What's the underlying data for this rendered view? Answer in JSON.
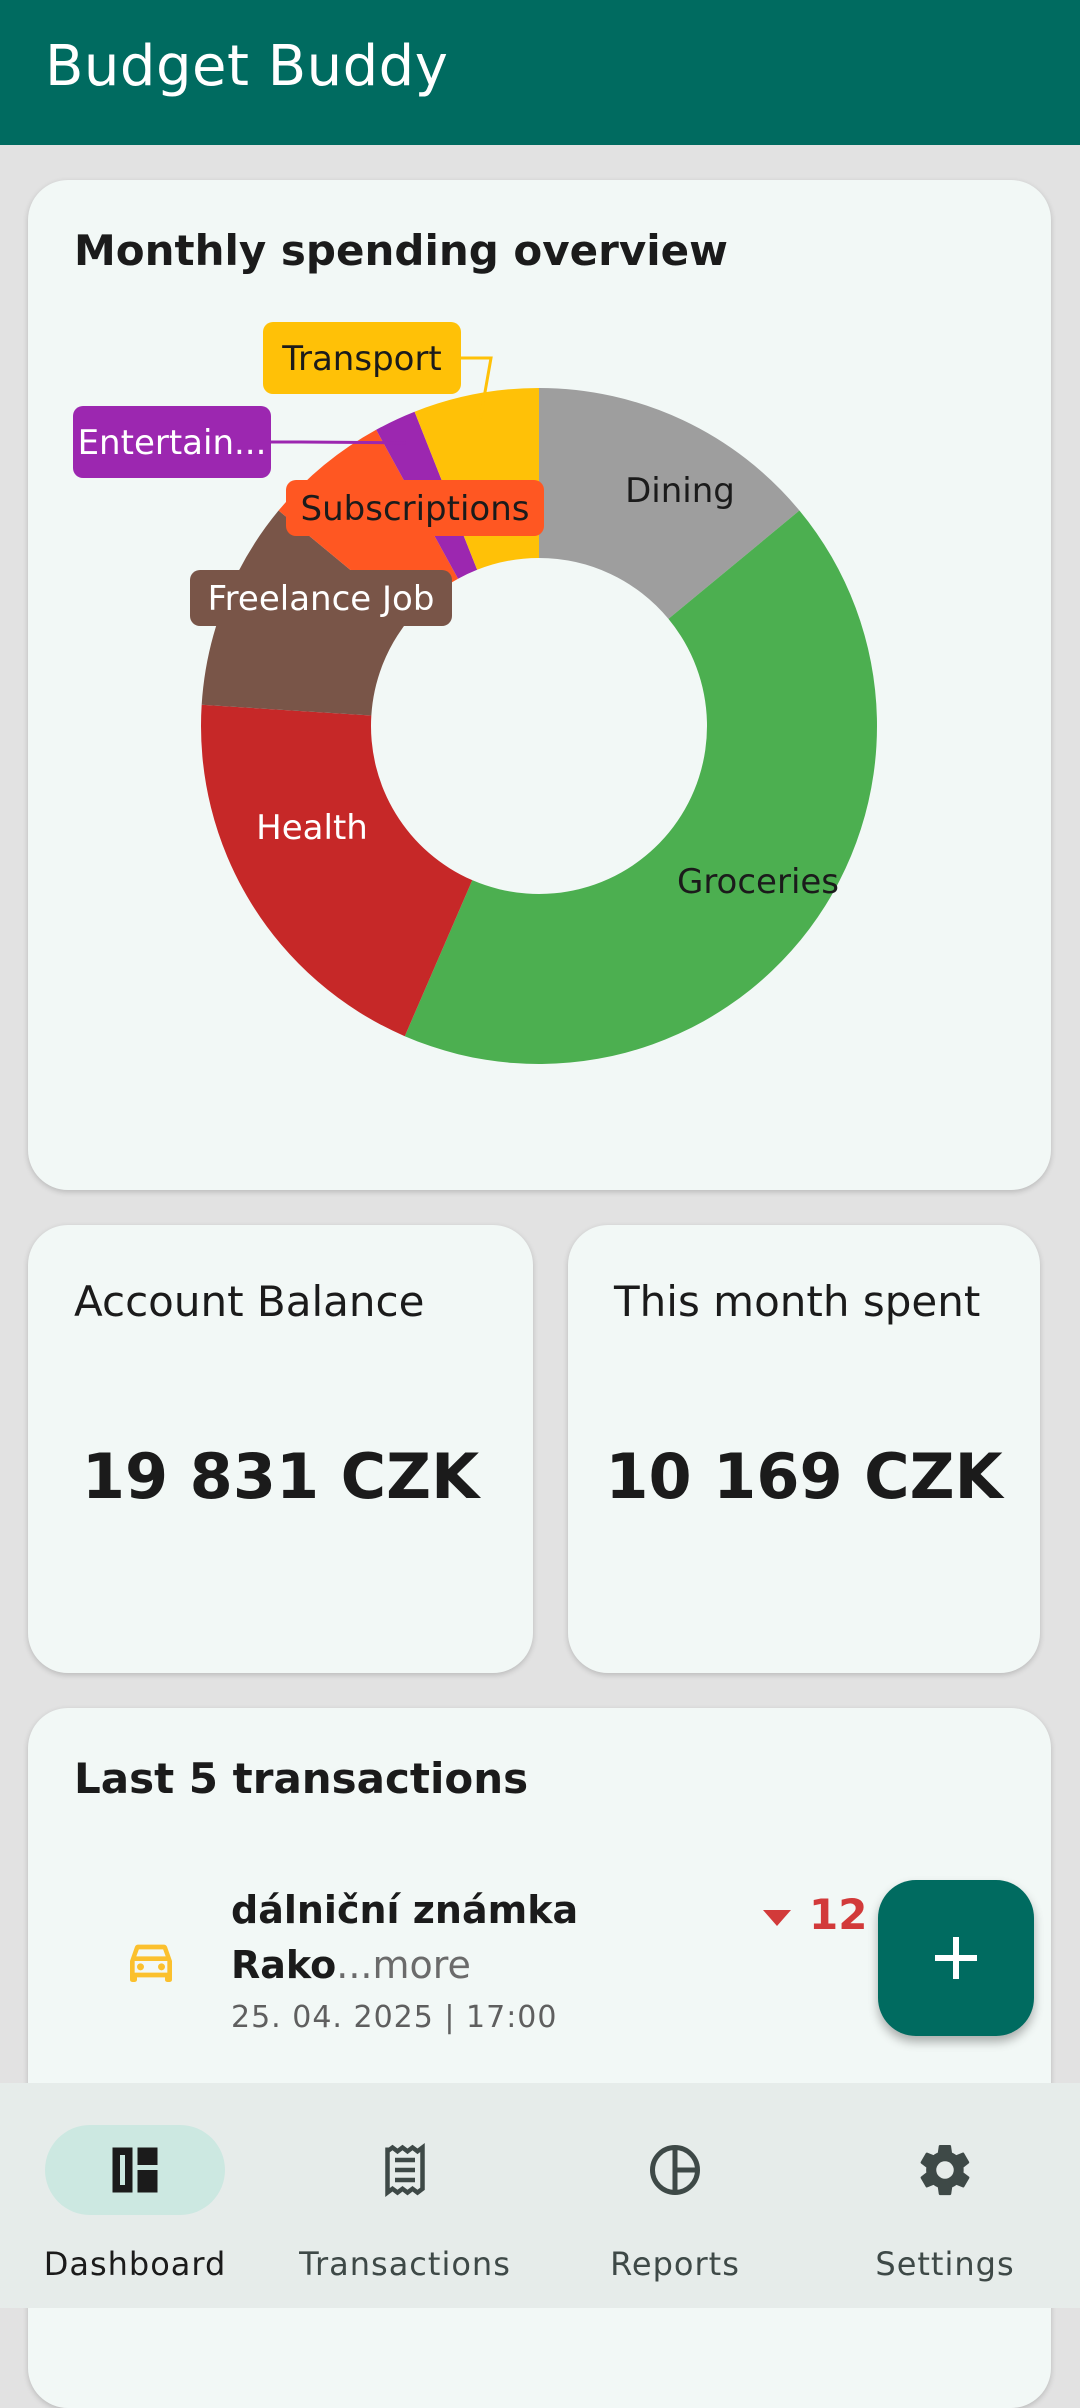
{
  "app": {
    "title": "Budget Buddy"
  },
  "chart_card": {
    "title": "Monthly spending overview"
  },
  "chart_data": {
    "type": "pie",
    "title": "Monthly spending overview",
    "donut": true,
    "series": [
      {
        "name": "Dining",
        "value": 14,
        "color": "#9e9e9e",
        "label": "Dining"
      },
      {
        "name": "Groceries",
        "value": 42.5,
        "color": "#4caf50",
        "label": "Groceries"
      },
      {
        "name": "Health",
        "value": 19.5,
        "color": "#c62828",
        "label": "Health"
      },
      {
        "name": "Freelance Job",
        "value": 10,
        "color": "#795548",
        "label": "Freelance Job"
      },
      {
        "name": "Subscriptions",
        "value": 6,
        "color": "#ff5722",
        "label": "Subscriptions"
      },
      {
        "name": "Entertainment",
        "value": 2,
        "color": "#9c27b0",
        "label": "Entertain..."
      },
      {
        "name": "Transport",
        "value": 6,
        "color": "#ffc107",
        "label": "Transport"
      }
    ]
  },
  "balance": {
    "label": "Account Balance",
    "value": "19 831 CZK"
  },
  "spent": {
    "label": "This month spent",
    "value": "10 169 CZK"
  },
  "transactions": {
    "title": "Last 5 transactions",
    "items": [
      {
        "name": "dálniční známka",
        "desc": "Rako",
        "more": "...more",
        "date": "25. 04. 2025 | 17:00",
        "amount": "12 E",
        "icon": "car-icon",
        "icon_color": "#fbc02d"
      }
    ]
  },
  "fab": {
    "icon": "plus-icon"
  },
  "nav": {
    "items": [
      {
        "label": "Dashboard",
        "icon": "dashboard-icon",
        "active": true
      },
      {
        "label": "Transactions",
        "icon": "receipt-icon",
        "active": false
      },
      {
        "label": "Reports",
        "icon": "pie-chart-icon",
        "active": false
      },
      {
        "label": "Settings",
        "icon": "gear-icon",
        "active": false
      }
    ]
  },
  "colors": {
    "primary": "#006b60",
    "background": "#e2e2e2",
    "card": "#f2f8f6",
    "negative": "#d23a3a"
  }
}
